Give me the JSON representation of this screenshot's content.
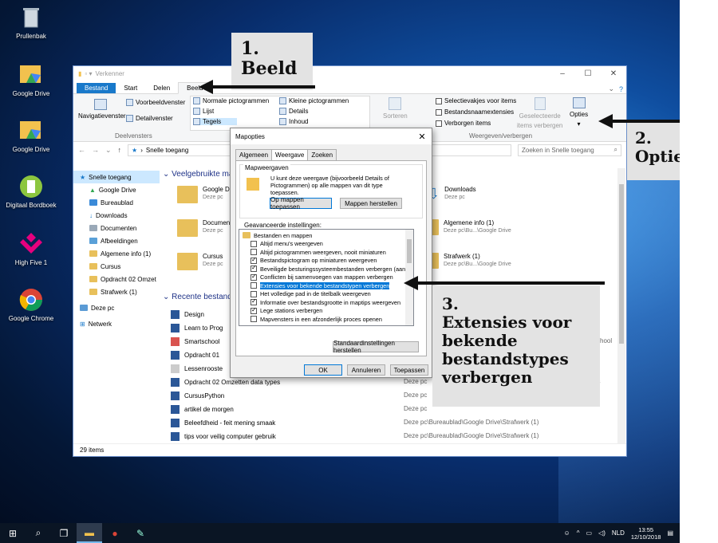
{
  "desktop_icons": [
    {
      "label": "Prullenbak"
    },
    {
      "label": "Google Drive"
    },
    {
      "label": "Google Drive"
    },
    {
      "label": "Digitaal Bordboek"
    },
    {
      "label": "High Five 1"
    },
    {
      "label": "Google Chrome"
    }
  ],
  "callouts": {
    "c1_num": "1.",
    "c1_text": "Beeld",
    "c2_num": "2.",
    "c2_text": "Opties",
    "c3_num": "3.",
    "c3_line1": "Extensies voor",
    "c3_line2": "bekende",
    "c3_line3": "bestandstypes",
    "c3_line4": "verbergen"
  },
  "explorer": {
    "title": "Verkenner",
    "tabs": [
      "Bestand",
      "Start",
      "Delen",
      "Beeld"
    ],
    "ribbon": {
      "nav_pane": "Navigatievenster",
      "preview": "Voorbeeldvenster",
      "details_pane": "Detailvenster",
      "group_panes": "Deelvensters",
      "normal_icons": "Normale pictogrammen",
      "small_icons": "Kleine pictogrammen",
      "list": "Lijst",
      "details": "Details",
      "tiles": "Tegels",
      "content": "Inhoud",
      "sort": "Sorteren",
      "cb_item": "Selectievakjes voor items",
      "cb_ext": "Bestandsnaamextensies",
      "cb_hidden": "Verborgen items",
      "hide_selected_1": "Geselecteerde",
      "hide_selected_2": "items verbergen",
      "options": "Opties",
      "group_showhide": "Weergeven/verbergen"
    },
    "address": "Snelle toegang",
    "search_placeholder": "Zoeken in Snelle toegang",
    "nav": [
      "Snelle toegang",
      "Google Drive",
      "Bureaublad",
      "Downloads",
      "Documenten",
      "Afbeeldingen",
      "Algemene info (1)",
      "Cursus",
      "Opdracht 02 Omzet",
      "Strafwerk (1)",
      "Deze pc",
      "Netwerk"
    ],
    "frequent_header": "Veelgebruikte ma",
    "frequent": [
      {
        "name": "Google D",
        "sub": "Deze pc"
      },
      {
        "name": "Documen",
        "sub": "Deze pc"
      },
      {
        "name": "Cursus",
        "sub": "Deze pc"
      },
      {
        "name": "Downloads",
        "sub": "Deze pc"
      },
      {
        "name": "Algemene info (1)",
        "sub": "Deze pc\\Bu...\\Google Drive"
      },
      {
        "name": "Strafwerk (1)",
        "sub": "Deze pc\\Bu...\\Google Drive"
      }
    ],
    "recent_header": "Recente bestand",
    "recent": [
      {
        "name": "Design",
        "loc": ""
      },
      {
        "name": "Learn to Prog",
        "loc": ""
      },
      {
        "name": "Smartschool",
        "loc": "school"
      },
      {
        "name": "Opdracht 01",
        "loc": ""
      },
      {
        "name": "Lessenrooste",
        "loc": ""
      },
      {
        "name": "Opdracht 02 Omzetten data types",
        "loc": "Deze pc"
      },
      {
        "name": "CursusPython",
        "loc": "Deze pc"
      },
      {
        "name": "artikel de morgen",
        "loc": "Deze pc"
      },
      {
        "name": "Beleefdheid - feit mening smaak",
        "loc": "Deze pc\\Bureaublad\\Google Drive\\Strafwerk (1)"
      },
      {
        "name": "tips voor veilig computer gebruik",
        "loc": "Deze pc\\Bureaublad\\Google Drive\\Strafwerk (1)"
      }
    ],
    "recent_extra_locs": [
      "Deze pc\\Bureaublad\\Google Drive\\Strafwerk (1)",
      "Deze pc\\Bureaublad\\Google Drive\\Strafwerk (1)",
      "es"
    ],
    "status": "29 items"
  },
  "dialog": {
    "title": "Mapopties",
    "tabs": [
      "Algemeen",
      "Weergave",
      "Zoeken"
    ],
    "folder_views": "Mapweergaven",
    "folder_desc": "U kunt deze weergave (bijvoorbeeld Details of Pictogrammen) op alle mappen van dit type toepassen.",
    "apply_folders": "Op mappen toepassen",
    "reset_folders": "Mappen herstellen",
    "advanced": "Geavanceerde instellingen:",
    "tree": [
      {
        "label": "Bestanden en mappen",
        "checked": null
      },
      {
        "label": "Altijd menu's weergeven",
        "checked": false
      },
      {
        "label": "Altijd pictogrammen weergeven, nooit miniaturen",
        "checked": false
      },
      {
        "label": "Bestandspictogram op miniaturen weergeven",
        "checked": true
      },
      {
        "label": "Beveiligde besturingssysteembestanden verbergen (aanb",
        "checked": true
      },
      {
        "label": "Conflicten bij samenvoegen van mappen verbergen",
        "checked": true
      },
      {
        "label": "Extensies voor bekende bestandstypen verbergen",
        "checked": false
      },
      {
        "label": "Het volledige pad in de titelbalk weergeven",
        "checked": false
      },
      {
        "label": "Informatie over bestandsgrootte in maptips weergeven",
        "checked": true
      },
      {
        "label": "Lege stations verbergen",
        "checked": true
      },
      {
        "label": "Mapvensters in een afzonderlijk proces openen",
        "checked": false
      }
    ],
    "restore_defaults": "Standaardinstellingen herstellen",
    "ok": "OK",
    "cancel": "Annuleren",
    "apply": "Toepassen"
  },
  "taskbar": {
    "lang": "NLD",
    "time": "13:55",
    "date": "12/10/2018"
  }
}
